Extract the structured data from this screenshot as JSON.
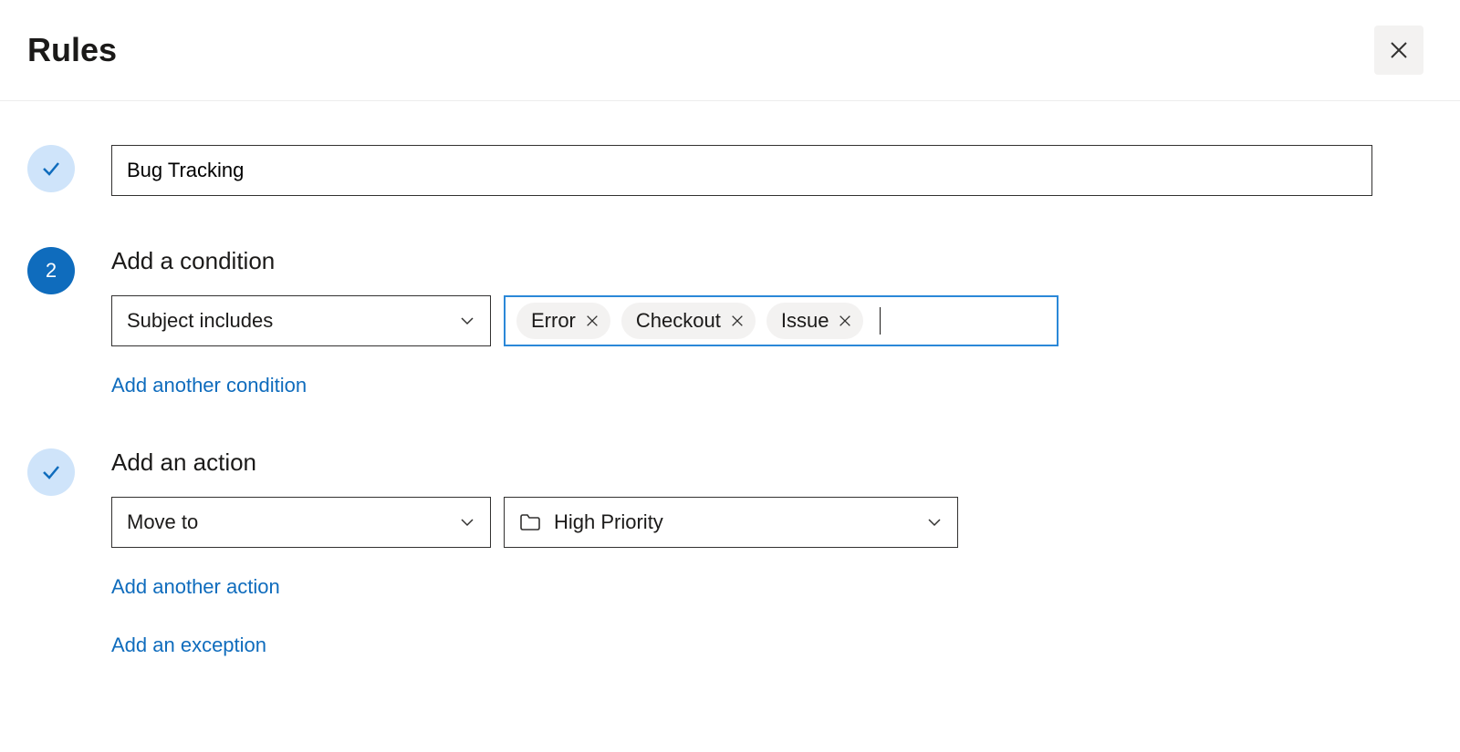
{
  "header": {
    "title": "Rules"
  },
  "step1": {
    "rule_name": "Bug Tracking"
  },
  "step2": {
    "number": "2",
    "title": "Add a condition",
    "condition_type": "Subject includes",
    "tags": [
      "Error",
      "Checkout",
      "Issue"
    ],
    "add_another_label": "Add another condition"
  },
  "step3": {
    "title": "Add an action",
    "action_type": "Move to",
    "folder": "High Priority",
    "add_another_label": "Add another action",
    "add_exception_label": "Add an exception"
  }
}
